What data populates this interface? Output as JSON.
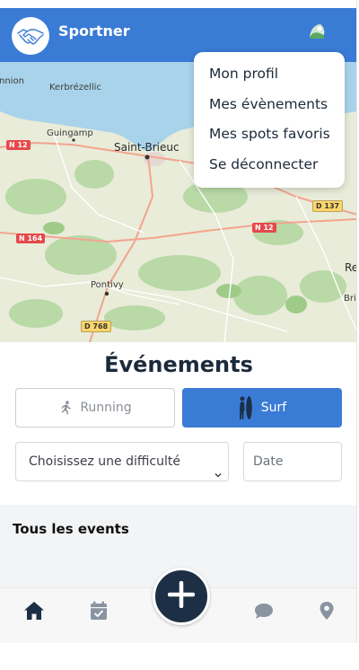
{
  "header": {
    "app_title": "Sportner",
    "brand_color": "#3a7bd5",
    "logo_icon": "handshake-icon",
    "avatar_icon": "profile-avatar"
  },
  "map": {
    "places": [
      {
        "label": "nnion",
        "size": "normal"
      },
      {
        "label": "Kerbrézellic",
        "size": "normal"
      },
      {
        "label": "Guingamp",
        "size": "normal"
      },
      {
        "label": "Saint-Brieuc",
        "size": "big"
      },
      {
        "label": "Pontivy",
        "size": "normal"
      },
      {
        "label": "Re",
        "size": "big"
      },
      {
        "label": "Bri",
        "size": "normal"
      }
    ],
    "roads": [
      {
        "label": "N 12",
        "style": "red"
      },
      {
        "label": "N 164",
        "style": "red"
      },
      {
        "label": "N 12",
        "style": "red"
      },
      {
        "label": "D 137",
        "style": "yellow"
      },
      {
        "label": "D 768",
        "style": "yellow"
      }
    ]
  },
  "menu": {
    "items": [
      {
        "label": "Mon profil"
      },
      {
        "label": "Mes évènements"
      },
      {
        "label": "Mes spots favoris"
      },
      {
        "label": "Se déconnecter"
      }
    ]
  },
  "events": {
    "title": "Événements",
    "sports": [
      {
        "label": "Running",
        "icon": "running-icon",
        "selected": false
      },
      {
        "label": "Surf",
        "icon": "surfer-icon",
        "selected": true
      }
    ],
    "difficulty": {
      "selected": "Choisissez une difficulté"
    },
    "date": {
      "placeholder": "Date"
    },
    "list_heading": "Tous les events"
  },
  "nav": {
    "items": [
      {
        "icon": "home-icon",
        "active": true
      },
      {
        "icon": "calendar-check-icon",
        "active": false
      },
      {
        "icon": "plus-icon",
        "active": false
      },
      {
        "icon": "chat-bubble-icon",
        "active": false
      },
      {
        "icon": "location-pin-icon",
        "active": false
      }
    ],
    "active_color": "#1c2f45",
    "inactive_color": "#8a94a0"
  }
}
